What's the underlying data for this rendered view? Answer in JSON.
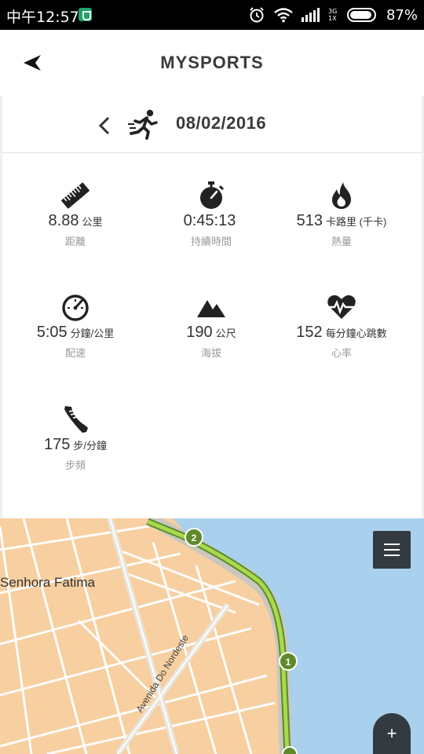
{
  "status_bar": {
    "time": "中午12:57",
    "network": "3G 1X",
    "battery": "87%"
  },
  "header": {
    "title": "MYSPORTS"
  },
  "activity": {
    "date": "08/02/2016",
    "type_icon": "running-person-icon"
  },
  "stats": [
    {
      "icon": "ruler-icon",
      "value": "8.88",
      "unit": "公里",
      "label": "距離"
    },
    {
      "icon": "stopwatch-icon",
      "value": "0:45:13",
      "unit": "",
      "label": "持續時間"
    },
    {
      "icon": "flame-icon",
      "value": "513",
      "unit": "卡路里 (千卡)",
      "label": "熱量"
    },
    {
      "icon": "speedometer-icon",
      "value": "5:05",
      "unit": "分鐘/公里",
      "label": "配速"
    },
    {
      "icon": "mountain-icon",
      "value": "190",
      "unit": "公尺",
      "label": "海拔"
    },
    {
      "icon": "heart-rate-icon",
      "value": "152",
      "unit": "每分鐘心跳數",
      "label": "心率"
    },
    {
      "icon": "shoe-icon",
      "value": "175",
      "unit": "步/分鐘",
      "label": "步頻"
    }
  ],
  "map": {
    "place_label": "Senhora Fatima",
    "street_label": "Avenida Do Nordeste",
    "markers": [
      "2",
      "1"
    ],
    "add_label": "+",
    "colors": {
      "land": "#f7cfa0",
      "water": "#a9d0ec",
      "route": "#8dc63f",
      "marker": "#5e8a2a"
    }
  }
}
